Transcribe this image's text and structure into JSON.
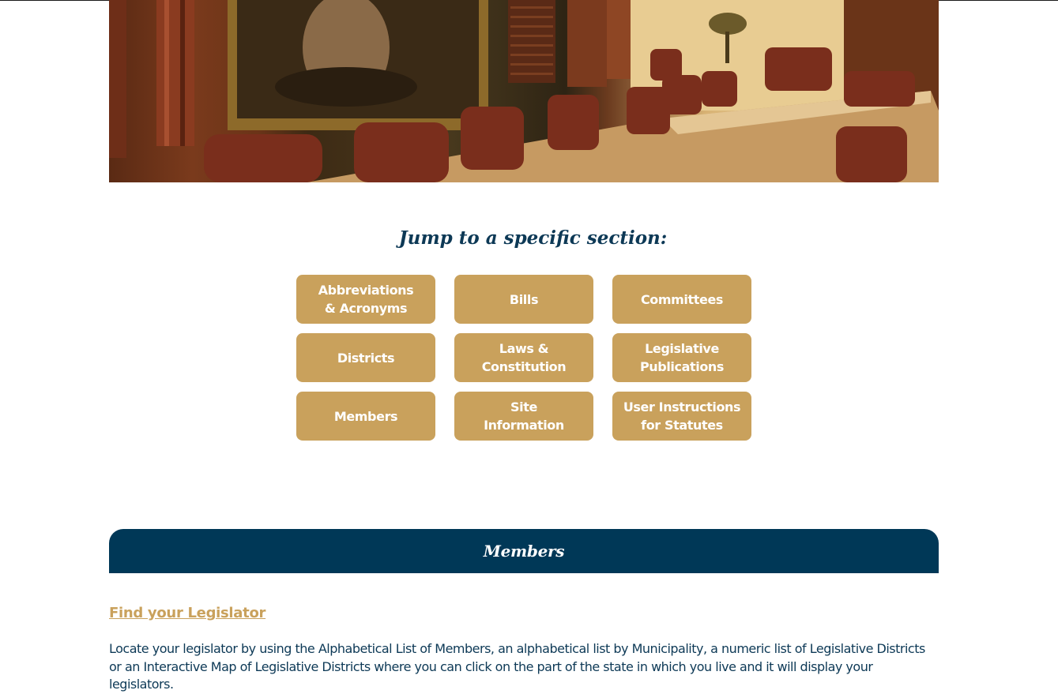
{
  "jump": {
    "heading": "Jump to a specific section:",
    "buttons": [
      {
        "label": "Abbreviations\n& Acronyms"
      },
      {
        "label": "Bills"
      },
      {
        "label": "Committees"
      },
      {
        "label": "Districts"
      },
      {
        "label": "Laws &\nConstitution"
      },
      {
        "label": "Legislative\nPublications"
      },
      {
        "label": "Members"
      },
      {
        "label": "Site\nInformation"
      },
      {
        "label": "User Instructions\nfor Statutes"
      }
    ]
  },
  "members_section": {
    "title": "Members",
    "link_label": "Find your Legislator",
    "description": "Locate your legislator by using the Alphabetical List of Members, an alphabetical list by Municipality, a numeric list of Legislative Districts or an Interactive Map of Legislative Districts where you can click on the part of the state in which you live and it will display your legislators."
  },
  "colors": {
    "navy": "#003857",
    "gold": "#c9a15c",
    "text": "#0d3956"
  }
}
